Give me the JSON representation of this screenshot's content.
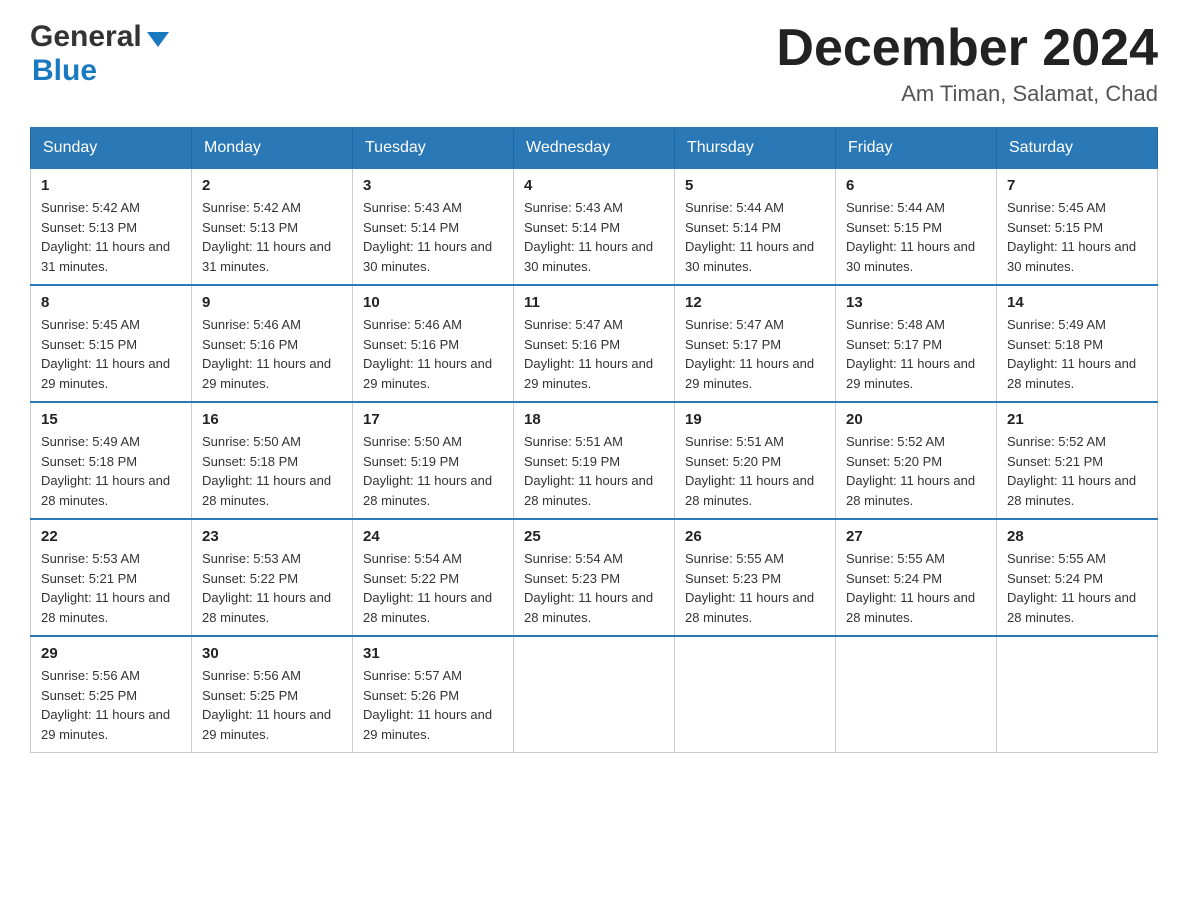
{
  "logo": {
    "general": "General",
    "blue": "Blue"
  },
  "title": {
    "month_year": "December 2024",
    "location": "Am Timan, Salamat, Chad"
  },
  "headers": [
    "Sunday",
    "Monday",
    "Tuesday",
    "Wednesday",
    "Thursday",
    "Friday",
    "Saturday"
  ],
  "weeks": [
    [
      {
        "day": "1",
        "sunrise": "Sunrise: 5:42 AM",
        "sunset": "Sunset: 5:13 PM",
        "daylight": "Daylight: 11 hours and 31 minutes."
      },
      {
        "day": "2",
        "sunrise": "Sunrise: 5:42 AM",
        "sunset": "Sunset: 5:13 PM",
        "daylight": "Daylight: 11 hours and 31 minutes."
      },
      {
        "day": "3",
        "sunrise": "Sunrise: 5:43 AM",
        "sunset": "Sunset: 5:14 PM",
        "daylight": "Daylight: 11 hours and 30 minutes."
      },
      {
        "day": "4",
        "sunrise": "Sunrise: 5:43 AM",
        "sunset": "Sunset: 5:14 PM",
        "daylight": "Daylight: 11 hours and 30 minutes."
      },
      {
        "day": "5",
        "sunrise": "Sunrise: 5:44 AM",
        "sunset": "Sunset: 5:14 PM",
        "daylight": "Daylight: 11 hours and 30 minutes."
      },
      {
        "day": "6",
        "sunrise": "Sunrise: 5:44 AM",
        "sunset": "Sunset: 5:15 PM",
        "daylight": "Daylight: 11 hours and 30 minutes."
      },
      {
        "day": "7",
        "sunrise": "Sunrise: 5:45 AM",
        "sunset": "Sunset: 5:15 PM",
        "daylight": "Daylight: 11 hours and 30 minutes."
      }
    ],
    [
      {
        "day": "8",
        "sunrise": "Sunrise: 5:45 AM",
        "sunset": "Sunset: 5:15 PM",
        "daylight": "Daylight: 11 hours and 29 minutes."
      },
      {
        "day": "9",
        "sunrise": "Sunrise: 5:46 AM",
        "sunset": "Sunset: 5:16 PM",
        "daylight": "Daylight: 11 hours and 29 minutes."
      },
      {
        "day": "10",
        "sunrise": "Sunrise: 5:46 AM",
        "sunset": "Sunset: 5:16 PM",
        "daylight": "Daylight: 11 hours and 29 minutes."
      },
      {
        "day": "11",
        "sunrise": "Sunrise: 5:47 AM",
        "sunset": "Sunset: 5:16 PM",
        "daylight": "Daylight: 11 hours and 29 minutes."
      },
      {
        "day": "12",
        "sunrise": "Sunrise: 5:47 AM",
        "sunset": "Sunset: 5:17 PM",
        "daylight": "Daylight: 11 hours and 29 minutes."
      },
      {
        "day": "13",
        "sunrise": "Sunrise: 5:48 AM",
        "sunset": "Sunset: 5:17 PM",
        "daylight": "Daylight: 11 hours and 29 minutes."
      },
      {
        "day": "14",
        "sunrise": "Sunrise: 5:49 AM",
        "sunset": "Sunset: 5:18 PM",
        "daylight": "Daylight: 11 hours and 28 minutes."
      }
    ],
    [
      {
        "day": "15",
        "sunrise": "Sunrise: 5:49 AM",
        "sunset": "Sunset: 5:18 PM",
        "daylight": "Daylight: 11 hours and 28 minutes."
      },
      {
        "day": "16",
        "sunrise": "Sunrise: 5:50 AM",
        "sunset": "Sunset: 5:18 PM",
        "daylight": "Daylight: 11 hours and 28 minutes."
      },
      {
        "day": "17",
        "sunrise": "Sunrise: 5:50 AM",
        "sunset": "Sunset: 5:19 PM",
        "daylight": "Daylight: 11 hours and 28 minutes."
      },
      {
        "day": "18",
        "sunrise": "Sunrise: 5:51 AM",
        "sunset": "Sunset: 5:19 PM",
        "daylight": "Daylight: 11 hours and 28 minutes."
      },
      {
        "day": "19",
        "sunrise": "Sunrise: 5:51 AM",
        "sunset": "Sunset: 5:20 PM",
        "daylight": "Daylight: 11 hours and 28 minutes."
      },
      {
        "day": "20",
        "sunrise": "Sunrise: 5:52 AM",
        "sunset": "Sunset: 5:20 PM",
        "daylight": "Daylight: 11 hours and 28 minutes."
      },
      {
        "day": "21",
        "sunrise": "Sunrise: 5:52 AM",
        "sunset": "Sunset: 5:21 PM",
        "daylight": "Daylight: 11 hours and 28 minutes."
      }
    ],
    [
      {
        "day": "22",
        "sunrise": "Sunrise: 5:53 AM",
        "sunset": "Sunset: 5:21 PM",
        "daylight": "Daylight: 11 hours and 28 minutes."
      },
      {
        "day": "23",
        "sunrise": "Sunrise: 5:53 AM",
        "sunset": "Sunset: 5:22 PM",
        "daylight": "Daylight: 11 hours and 28 minutes."
      },
      {
        "day": "24",
        "sunrise": "Sunrise: 5:54 AM",
        "sunset": "Sunset: 5:22 PM",
        "daylight": "Daylight: 11 hours and 28 minutes."
      },
      {
        "day": "25",
        "sunrise": "Sunrise: 5:54 AM",
        "sunset": "Sunset: 5:23 PM",
        "daylight": "Daylight: 11 hours and 28 minutes."
      },
      {
        "day": "26",
        "sunrise": "Sunrise: 5:55 AM",
        "sunset": "Sunset: 5:23 PM",
        "daylight": "Daylight: 11 hours and 28 minutes."
      },
      {
        "day": "27",
        "sunrise": "Sunrise: 5:55 AM",
        "sunset": "Sunset: 5:24 PM",
        "daylight": "Daylight: 11 hours and 28 minutes."
      },
      {
        "day": "28",
        "sunrise": "Sunrise: 5:55 AM",
        "sunset": "Sunset: 5:24 PM",
        "daylight": "Daylight: 11 hours and 28 minutes."
      }
    ],
    [
      {
        "day": "29",
        "sunrise": "Sunrise: 5:56 AM",
        "sunset": "Sunset: 5:25 PM",
        "daylight": "Daylight: 11 hours and 29 minutes."
      },
      {
        "day": "30",
        "sunrise": "Sunrise: 5:56 AM",
        "sunset": "Sunset: 5:25 PM",
        "daylight": "Daylight: 11 hours and 29 minutes."
      },
      {
        "day": "31",
        "sunrise": "Sunrise: 5:57 AM",
        "sunset": "Sunset: 5:26 PM",
        "daylight": "Daylight: 11 hours and 29 minutes."
      },
      null,
      null,
      null,
      null
    ]
  ]
}
